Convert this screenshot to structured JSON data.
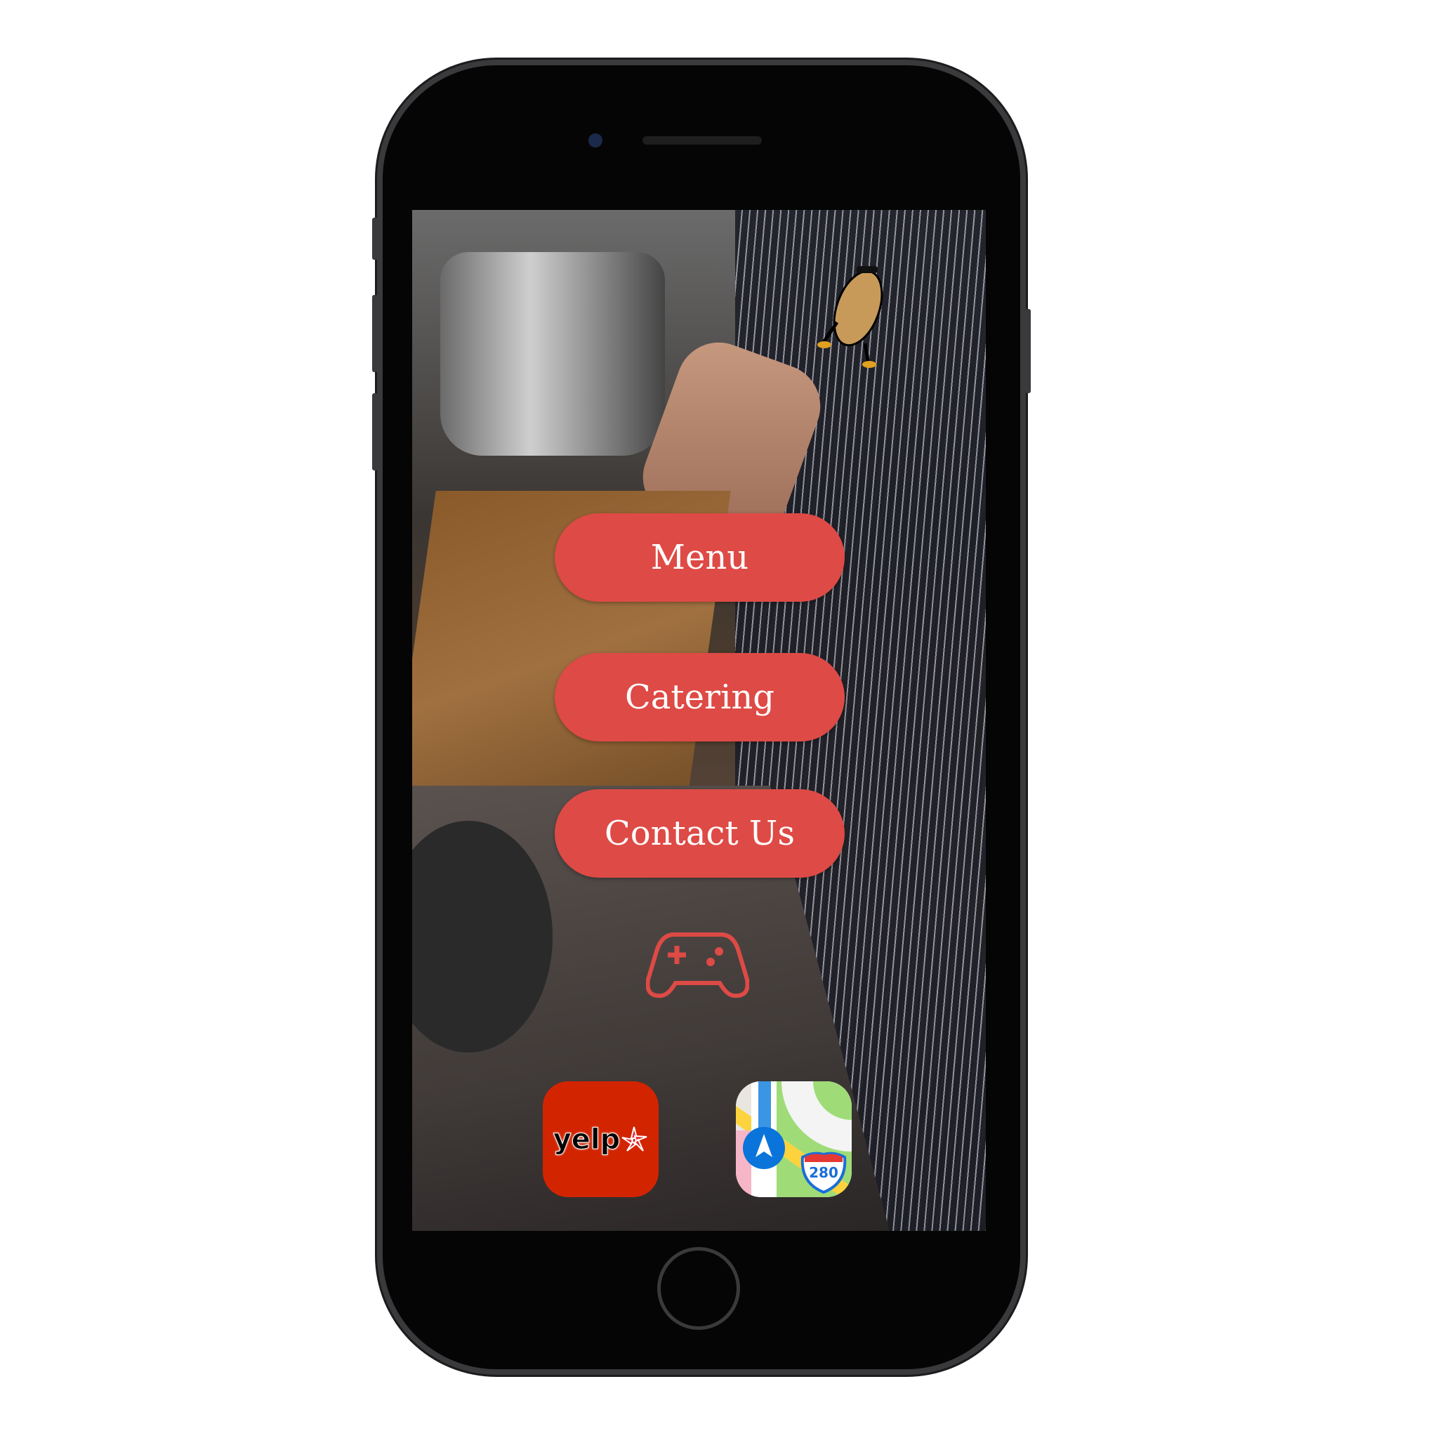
{
  "buttons": {
    "menu": "Menu",
    "catering": "Catering",
    "contact": "Contact Us"
  },
  "apps": {
    "yelp_label": "yelp",
    "maps_shield": "280"
  },
  "colors": {
    "button": "#de4a45",
    "yelp": "#d32400"
  }
}
